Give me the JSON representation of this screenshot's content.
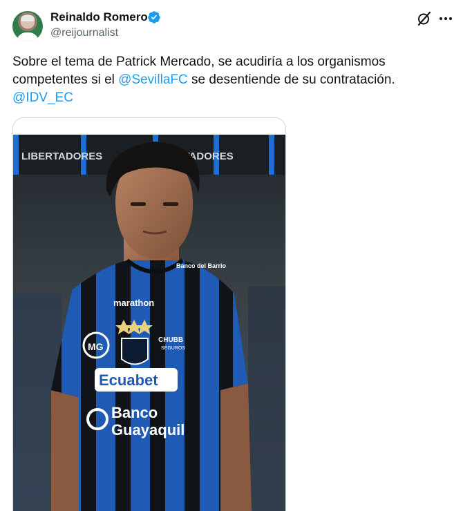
{
  "author": {
    "display_name": "Reinaldo Romero",
    "handle": "@reijournalist"
  },
  "tweet": {
    "text_1": "Sobre el tema de Patrick Mercado, se acudiría a los organismos competentes si el ",
    "mention_1": "@SevillaFC",
    "text_2": " se desentiende de su contratación.",
    "mention_2": "@IDV_EC"
  },
  "photo": {
    "stadium_banner_text": "LIBERTADORES",
    "stadium_banner_text_2": "PONTADORES",
    "jersey_sponsor_top": "marathon",
    "jersey_sponsor_chest": "Ecuabet",
    "jersey_sponsor_bank_1": "Banco",
    "jersey_sponsor_bank_2": "Guayaquil",
    "jersey_sponsor_side": "CHUBB",
    "jersey_sponsor_side_sub": "SEGUROS",
    "jersey_sponsor_shoulder": "Banco del Barrio",
    "jersey_logo_left": "MG"
  },
  "colors": {
    "verified": "#1d9bf0",
    "mention": "#1d9bf0",
    "jersey_blue": "#1f5bb5",
    "jersey_black": "#101418"
  },
  "icons": {
    "grok": "grok-icon",
    "more": "more-icon",
    "verified": "verified-badge-icon"
  }
}
